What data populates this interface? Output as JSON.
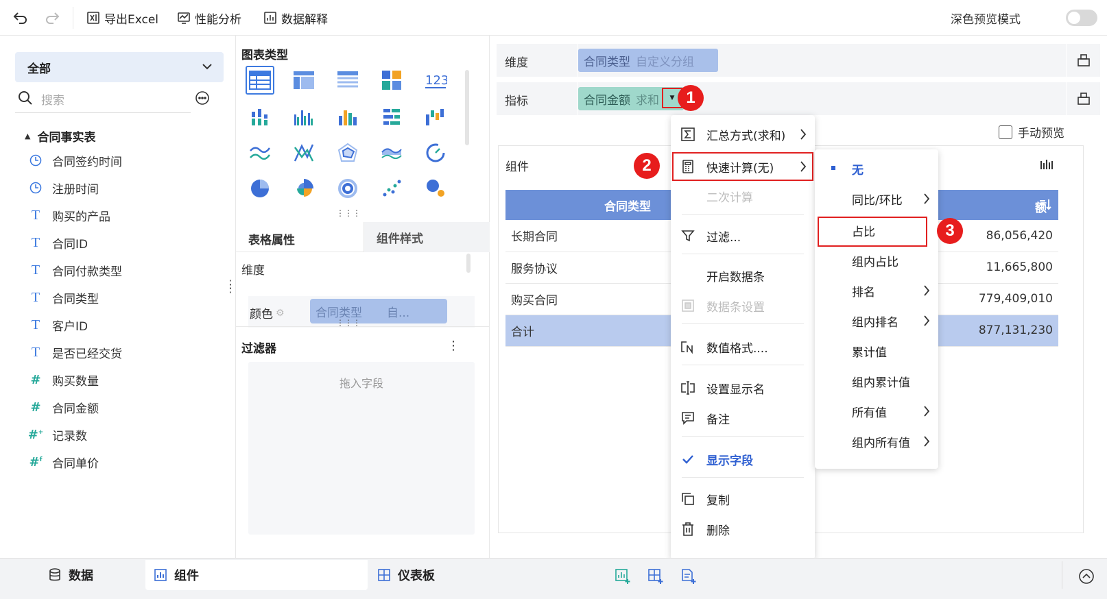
{
  "toolbar": {
    "export_label": "导出Excel",
    "perf_label": "性能分析",
    "explain_label": "数据解释",
    "dark_preview_label": "深色预览模式"
  },
  "left": {
    "scope_selected": "全部",
    "search_placeholder": "搜索",
    "table_name": "合同事实表",
    "fields": [
      {
        "label": "合同签约时间",
        "type": "date"
      },
      {
        "label": "注册时间",
        "type": "date"
      },
      {
        "label": "购买的产品",
        "type": "text"
      },
      {
        "label": "合同ID",
        "type": "text"
      },
      {
        "label": "合同付款类型",
        "type": "text"
      },
      {
        "label": "合同类型",
        "type": "text"
      },
      {
        "label": "客户ID",
        "type": "text"
      },
      {
        "label": "是否已经交货",
        "type": "text"
      },
      {
        "label": "购买数量",
        "type": "number"
      },
      {
        "label": "合同金额",
        "type": "number"
      },
      {
        "label": "记录数",
        "type": "number-calc"
      },
      {
        "label": "合同单价",
        "type": "number-formula"
      }
    ]
  },
  "middle": {
    "chart_type_title": "图表类型",
    "tab_table_props": "表格属性",
    "tab_component_style": "组件样式",
    "dimension_label": "维度",
    "color_label": "颜色",
    "color_pill_field": "合同类型",
    "color_pill_extra": "自...",
    "filter_title": "过滤器",
    "filter_drop_hint": "拖入字段"
  },
  "right": {
    "dim_label": "维度",
    "dim_pill_field": "合同类型",
    "dim_pill_extra": "自定义分组",
    "metric_label": "指标",
    "metric_pill_field": "合同金额",
    "metric_pill_agg": "求和",
    "manual_preview_label": "手动预览",
    "component_label": "组件",
    "table": {
      "headers": [
        "合同类型",
        "额"
      ],
      "rows": [
        {
          "type": "长期合同",
          "value": "86,056,420"
        },
        {
          "type": "服务协议",
          "value": "11,665,800"
        },
        {
          "type": "购买合同",
          "value": "779,409,010"
        }
      ],
      "total": {
        "type": "合计",
        "value": "877,131,230"
      }
    }
  },
  "menu": {
    "items": {
      "summary": "汇总方式(求和)",
      "quick_calc": "快速计算(无)",
      "secondary_calc": "二次计算",
      "filter": "过滤...",
      "databar_on": "开启数据条",
      "databar_settings": "数据条设置",
      "num_format": "数值格式....",
      "display_name": "设置显示名",
      "note": "备注",
      "show_field": "显示字段",
      "copy": "复制",
      "delete": "删除"
    }
  },
  "submenu": {
    "items": {
      "none": "无",
      "yoy": "同比/环比",
      "ratio": "占比",
      "group_ratio": "组内占比",
      "rank": "排名",
      "group_rank": "组内排名",
      "cumulative": "累计值",
      "group_cumulative": "组内累计值",
      "all_values": "所有值",
      "group_all_values": "组内所有值"
    }
  },
  "annotations": {
    "step1": "1",
    "step2": "2",
    "step3": "3"
  },
  "bottom": {
    "tab_data": "数据",
    "tab_component": "组件",
    "tab_dashboard": "仪表板"
  },
  "colors": {
    "accent": "#2e5fd1",
    "header_blue": "#6c90d8",
    "pill_blue": "#a9c0ea",
    "pill_green": "#9fd8cb",
    "highlight_red": "#e12020",
    "field_date_icon": "#3d7ae0",
    "field_number_icon": "#26a99a"
  }
}
